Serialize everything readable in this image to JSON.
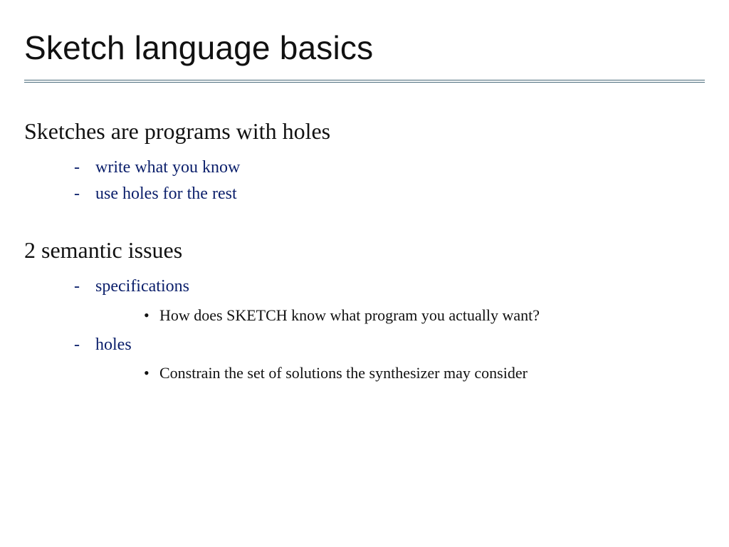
{
  "title": "Sketch language basics",
  "sections": [
    {
      "heading": "Sketches are programs with holes",
      "items": [
        {
          "text": "write what you know",
          "sub": []
        },
        {
          "text": "use holes for the rest",
          "sub": []
        }
      ]
    },
    {
      "heading": "2 semantic issues",
      "items": [
        {
          "text": "specifications",
          "sub": [
            "How does SKETCH know what program you actually want?"
          ]
        },
        {
          "text": "holes",
          "sub": [
            "Constrain the set of solutions the synthesizer may consider"
          ]
        }
      ]
    }
  ]
}
